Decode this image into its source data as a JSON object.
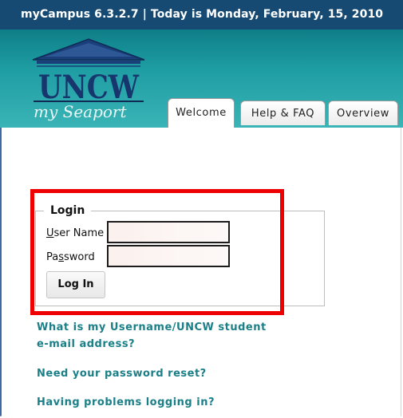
{
  "header": {
    "title": "myCampus 6.3.2.7 | Today is Monday, February, 15, 2010"
  },
  "logo": {
    "text": "UNCW",
    "tagline": "my Seaport"
  },
  "tabs": [
    {
      "label": "Welcome",
      "active": true
    },
    {
      "label": "Help & FAQ",
      "active": false
    },
    {
      "label": "Overview",
      "active": false
    }
  ],
  "login": {
    "legend": "Login",
    "username_label_first": "U",
    "username_label_rest": "ser Name",
    "password_label_first": "P",
    "password_label_mid": "a",
    "password_label_key": "s",
    "password_label_rest": "sword",
    "username_value": "",
    "password_value": "",
    "button_label": "Log In"
  },
  "links": [
    {
      "line1": "What is my Username/UNCW student",
      "line2": "e-mail address?"
    },
    {
      "line1": "Need your password reset?"
    },
    {
      "line1": "Having problems logging in?"
    }
  ],
  "colors": {
    "header_bg": "#174a73",
    "banner": "#1e9da3",
    "link": "#1b7f88",
    "highlight": "#ee0000"
  }
}
